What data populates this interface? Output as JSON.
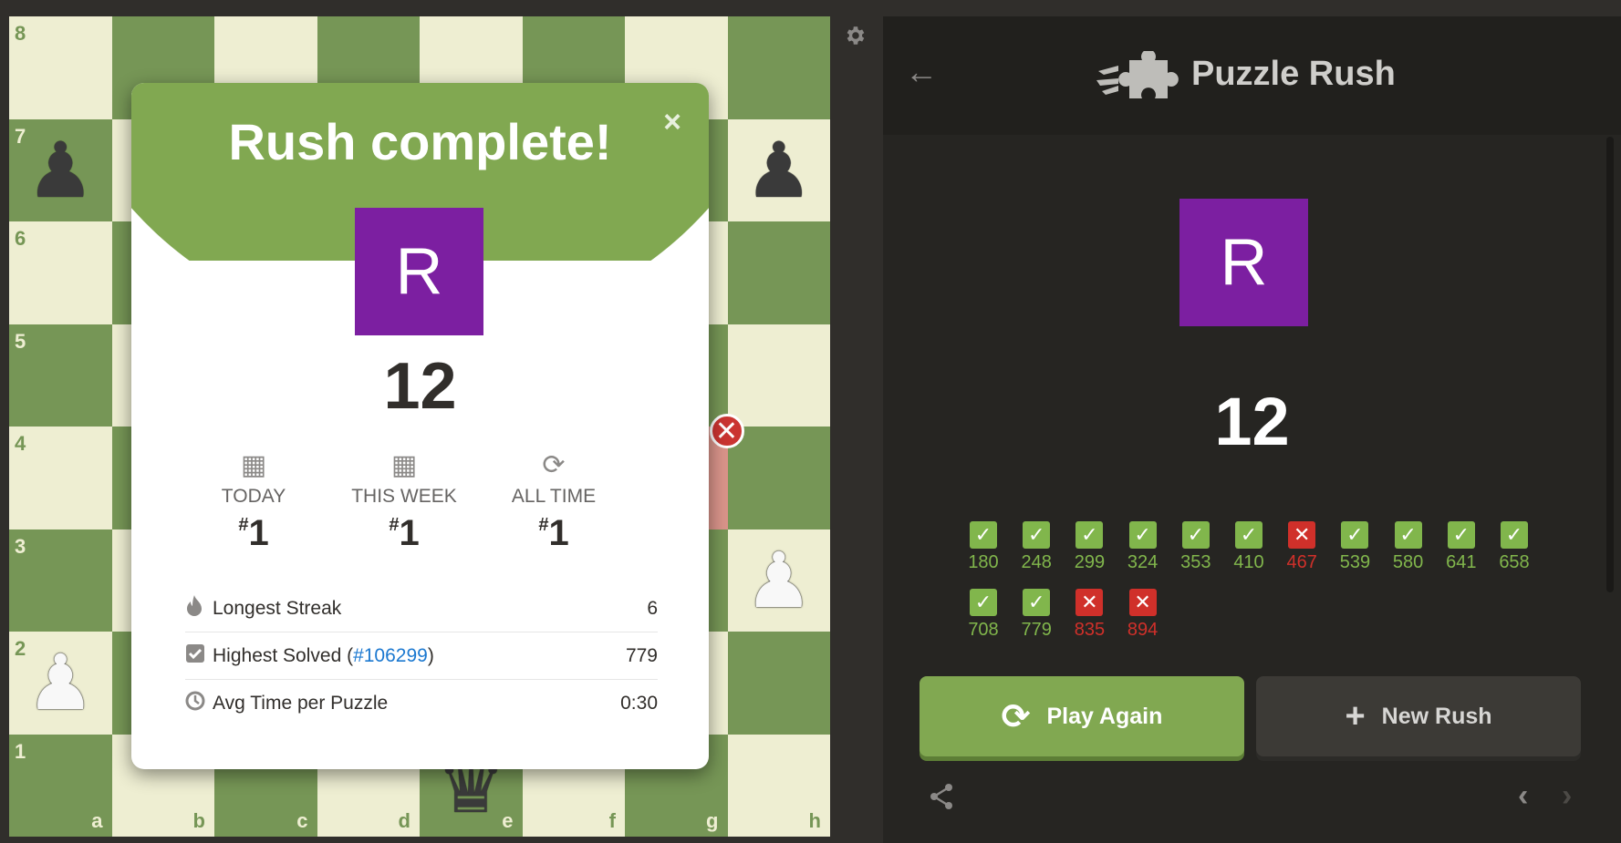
{
  "board": {
    "ranks": [
      "8",
      "7",
      "6",
      "5",
      "4",
      "3",
      "2",
      "1"
    ],
    "files": [
      "a",
      "b",
      "c",
      "d",
      "e",
      "f",
      "g",
      "h"
    ],
    "pieces": [
      {
        "square": "a7",
        "glyph": "♟",
        "color": "black",
        "name": "black-pawn-a7"
      },
      {
        "square": "h7",
        "glyph": "♟",
        "color": "black",
        "name": "black-pawn-h7"
      },
      {
        "square": "h3",
        "glyph": "♟",
        "color": "white",
        "name": "white-pawn-h3"
      },
      {
        "square": "a2",
        "glyph": "♟",
        "color": "white",
        "name": "white-pawn-a2"
      },
      {
        "square": "e1",
        "glyph": "♛",
        "color": "black",
        "name": "black-queen-e1"
      }
    ],
    "highlighted_square": "g4",
    "error_marker": "✕",
    "settings_icon": "gear-icon"
  },
  "modal": {
    "title": "Rush complete!",
    "close": "×",
    "avatar_letter": "R",
    "avatar_color": "#7c1fa1",
    "score": "12",
    "ranks": [
      {
        "icon": "calendar-icon",
        "label": "TODAY",
        "hash": "#",
        "value": "1"
      },
      {
        "icon": "calendar-icon",
        "label": "THIS WEEK",
        "hash": "#",
        "value": "1"
      },
      {
        "icon": "refresh-icon",
        "label": "ALL TIME",
        "hash": "#",
        "value": "1"
      }
    ],
    "stats": {
      "streak": {
        "icon": "flame-icon",
        "label": "Longest Streak",
        "value": "6"
      },
      "highest": {
        "icon": "checkbox-icon",
        "label_before": "Highest Solved (",
        "link": "#106299",
        "label_after": ")",
        "value": "779"
      },
      "avg": {
        "icon": "clock-icon",
        "label": "Avg Time per Puzzle",
        "value": "0:30"
      }
    }
  },
  "panel": {
    "back": "←",
    "title": "Puzzle Rush",
    "avatar_letter": "R",
    "score": "12",
    "results": [
      {
        "rating": "180",
        "ok": true
      },
      {
        "rating": "248",
        "ok": true
      },
      {
        "rating": "299",
        "ok": true
      },
      {
        "rating": "324",
        "ok": true
      },
      {
        "rating": "353",
        "ok": true
      },
      {
        "rating": "410",
        "ok": true
      },
      {
        "rating": "467",
        "ok": false
      },
      {
        "rating": "539",
        "ok": true
      },
      {
        "rating": "580",
        "ok": true
      },
      {
        "rating": "641",
        "ok": true
      },
      {
        "rating": "658",
        "ok": true
      },
      {
        "rating": "708",
        "ok": true
      },
      {
        "rating": "779",
        "ok": true
      },
      {
        "rating": "835",
        "ok": false
      },
      {
        "rating": "894",
        "ok": false
      }
    ],
    "check_glyph": "✓",
    "cross_glyph": "✕",
    "play_again": {
      "icon": "⟳",
      "label": "Play Again"
    },
    "new_rush": {
      "icon": "+",
      "label": "New Rush"
    },
    "share_icon": "share-icon",
    "prev": "‹",
    "next": "›",
    "colors": {
      "accent": "#81a851",
      "success": "#81b64c",
      "error": "#d0302a"
    }
  }
}
